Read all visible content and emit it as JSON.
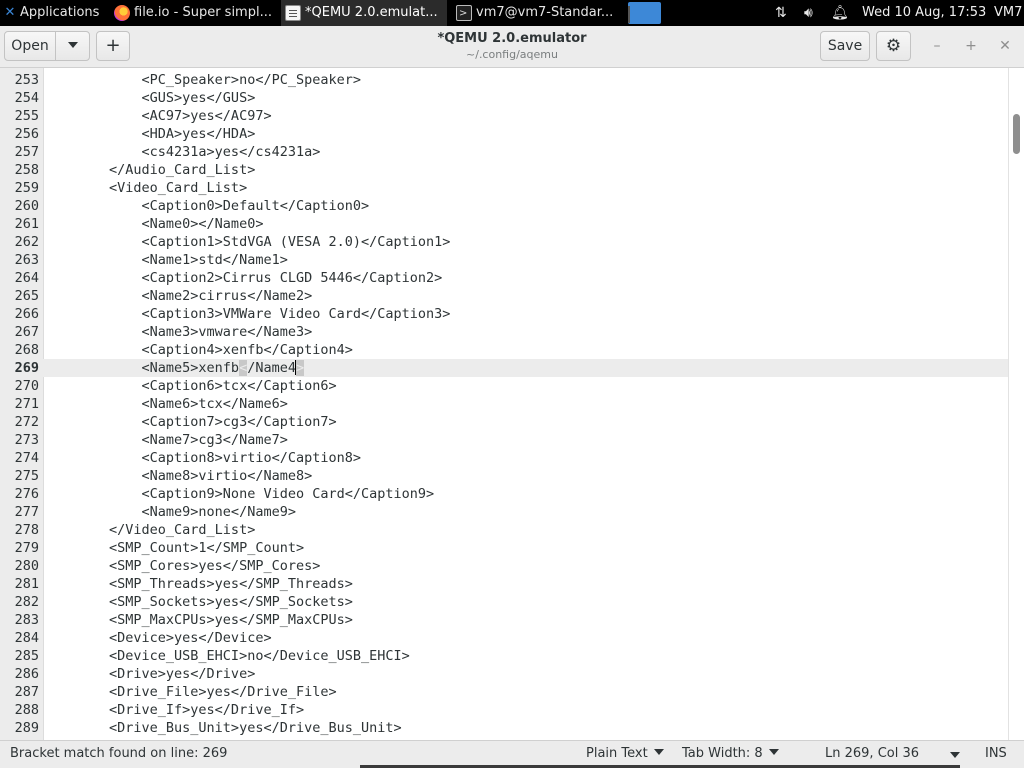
{
  "topbar": {
    "applications_label": "Applications",
    "tasks": [
      {
        "label": "file.io - Super simpl...",
        "icon": "firefox-icon"
      },
      {
        "label": "*QEMU 2.0.emulat...",
        "icon": "text-editor-icon"
      },
      {
        "label": "vm7@vm7-Standar...",
        "icon": "terminal-icon"
      }
    ],
    "clock": "Wed 10 Aug, 17:53",
    "user": "VM7"
  },
  "header": {
    "open_label": "Open",
    "new_label": "+",
    "title": "*QEMU 2.0.emulator",
    "subtitle": "~/.config/aqemu",
    "save_label": "Save"
  },
  "editor": {
    "current_line": 269,
    "lines": [
      {
        "n": "253",
        "text": "            <PC_Speaker>no</PC_Speaker>"
      },
      {
        "n": "254",
        "text": "            <GUS>yes</GUS>"
      },
      {
        "n": "255",
        "text": "            <AC97>yes</AC97>"
      },
      {
        "n": "256",
        "text": "            <HDA>yes</HDA>"
      },
      {
        "n": "257",
        "text": "            <cs4231a>yes</cs4231a>"
      },
      {
        "n": "258",
        "text": "        </Audio_Card_List>"
      },
      {
        "n": "259",
        "text": "        <Video_Card_List>"
      },
      {
        "n": "260",
        "text": "            <Caption0>Default</Caption0>"
      },
      {
        "n": "261",
        "text": "            <Name0></Name0>"
      },
      {
        "n": "262",
        "text": "            <Caption1>StdVGA (VESA 2.0)</Caption1>"
      },
      {
        "n": "263",
        "text": "            <Name1>std</Name1>"
      },
      {
        "n": "264",
        "text": "            <Caption2>Cirrus CLGD 5446</Caption2>"
      },
      {
        "n": "265",
        "text": "            <Name2>cirrus</Name2>"
      },
      {
        "n": "266",
        "text": "            <Caption3>VMWare Video Card</Caption3>"
      },
      {
        "n": "267",
        "text": "            <Name3>vmware</Name3>"
      },
      {
        "n": "268",
        "text": "            <Caption4>xenfb</Caption4>"
      },
      {
        "n": "269",
        "text": "            <Name5>xenfb</Name4>"
      },
      {
        "n": "270",
        "text": "            <Caption6>tcx</Caption6>"
      },
      {
        "n": "271",
        "text": "            <Name6>tcx</Name6>"
      },
      {
        "n": "272",
        "text": "            <Caption7>cg3</Caption7>"
      },
      {
        "n": "273",
        "text": "            <Name7>cg3</Name7>"
      },
      {
        "n": "274",
        "text": "            <Caption8>virtio</Caption8>"
      },
      {
        "n": "275",
        "text": "            <Name8>virtio</Name8>"
      },
      {
        "n": "276",
        "text": "            <Caption9>None Video Card</Caption9>"
      },
      {
        "n": "277",
        "text": "            <Name9>none</Name9>"
      },
      {
        "n": "278",
        "text": "        </Video_Card_List>"
      },
      {
        "n": "279",
        "text": "        <SMP_Count>1</SMP_Count>"
      },
      {
        "n": "280",
        "text": "        <SMP_Cores>yes</SMP_Cores>"
      },
      {
        "n": "281",
        "text": "        <SMP_Threads>yes</SMP_Threads>"
      },
      {
        "n": "282",
        "text": "        <SMP_Sockets>yes</SMP_Sockets>"
      },
      {
        "n": "283",
        "text": "        <SMP_MaxCPUs>yes</SMP_MaxCPUs>"
      },
      {
        "n": "284",
        "text": "        <Device>yes</Device>"
      },
      {
        "n": "285",
        "text": "        <Device_USB_EHCI>no</Device_USB_EHCI>"
      },
      {
        "n": "286",
        "text": "        <Drive>yes</Drive>"
      },
      {
        "n": "287",
        "text": "        <Drive_File>yes</Drive_File>"
      },
      {
        "n": "288",
        "text": "        <Drive_If>yes</Drive_If>"
      },
      {
        "n": "289",
        "text": "        <Drive_Bus_Unit>yes</Drive_Bus_Unit>"
      }
    ]
  },
  "status": {
    "message": "Bracket match found on line: 269",
    "language": "Plain Text",
    "tab_width": "Tab Width: 8",
    "position": "Ln 269, Col 36",
    "mode": "INS"
  },
  "colors": {
    "topbar_bg": "#000000",
    "active_task_bg": "#3d88d7",
    "current_line_bg": "#ececec",
    "gutter_bg": "#ececec"
  }
}
